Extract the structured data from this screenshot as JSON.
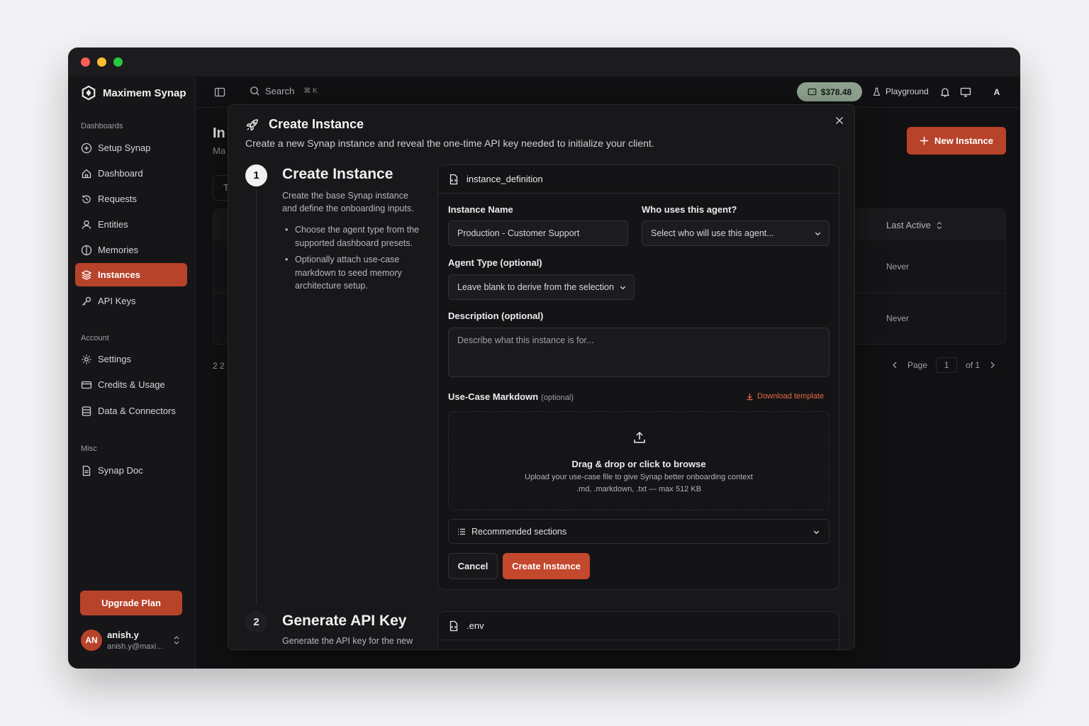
{
  "app": {
    "brand": "Maximem Synap"
  },
  "sidebar": {
    "sections": {
      "dashboards": "Dashboards",
      "account": "Account",
      "misc": "Misc"
    },
    "items": [
      {
        "label": "Setup Synap",
        "icon": "plus-circle-icon"
      },
      {
        "label": "Dashboard",
        "icon": "home-icon"
      },
      {
        "label": "Requests",
        "icon": "history-icon"
      },
      {
        "label": "Entities",
        "icon": "user-icon"
      },
      {
        "label": "Memories",
        "icon": "half-circle-icon"
      },
      {
        "label": "Instances",
        "icon": "layers-icon",
        "active": true
      },
      {
        "label": "API Keys",
        "icon": "key-icon"
      },
      {
        "label": "Settings",
        "icon": "gear-icon"
      },
      {
        "label": "Credits & Usage",
        "icon": "credit-card-icon"
      },
      {
        "label": "Data & Connectors",
        "icon": "database-icon"
      },
      {
        "label": "Synap Doc",
        "icon": "document-icon"
      }
    ],
    "upgrade_label": "Upgrade Plan",
    "user": {
      "initials": "AN",
      "name": "anish.y",
      "email": "anish.y@maxi..."
    }
  },
  "topbar": {
    "search_label": "Search",
    "search_shortcut": "⌘ K",
    "credits": "$378.48",
    "playground": "Playground",
    "avatar": "A"
  },
  "background_page": {
    "title_partial": "In",
    "subtitle_partial": "Ma",
    "tab_partial": "T",
    "new_instance_label": "New Instance",
    "column_last_active": "Last Active",
    "rows_last_active": [
      "Never",
      "Never"
    ],
    "count_partial": "2 2",
    "pager": {
      "page_label": "Page",
      "page_value": "1",
      "of_label": "of 1"
    }
  },
  "modal": {
    "title": "Create Instance",
    "description": "Create a new Synap instance and reveal the one-time API key needed to initialize your client.",
    "step1": {
      "number": "1",
      "title": "Create Instance",
      "text": "Create the base Synap instance and define the onboarding inputs.",
      "bullets": [
        "Choose the agent type from the supported dashboard presets.",
        "Optionally attach use-case markdown to seed memory architecture setup."
      ]
    },
    "step2": {
      "number": "2",
      "title": "Generate API Key",
      "text": "Generate the API key for the new instance"
    },
    "card1": {
      "header": "instance_definition",
      "instance_name_label": "Instance Name",
      "instance_name_value": "Production - Customer Support",
      "who_label": "Who uses this agent?",
      "who_placeholder": "Select who will use this agent...",
      "agent_type_label": "Agent Type (optional)",
      "agent_type_value": "Leave blank to derive from the selection",
      "description_label": "Description (optional)",
      "description_placeholder": "Describe what this instance is for...",
      "markdown_label": "Use-Case Markdown",
      "markdown_optional": "(optional)",
      "download_template": "Download template",
      "dropzone_title": "Drag & drop or click to browse",
      "dropzone_line1": "Upload your use-case file to give Synap better onboarding context",
      "dropzone_line2": ".md, .markdown, .txt — max 512 KB",
      "recommended": "Recommended sections",
      "cancel": "Cancel",
      "create": "Create Instance"
    },
    "card2": {
      "header": ".env"
    }
  },
  "colors": {
    "accent": "#b8432b",
    "credits_badge": "#8fa28f",
    "background": "#111113"
  }
}
